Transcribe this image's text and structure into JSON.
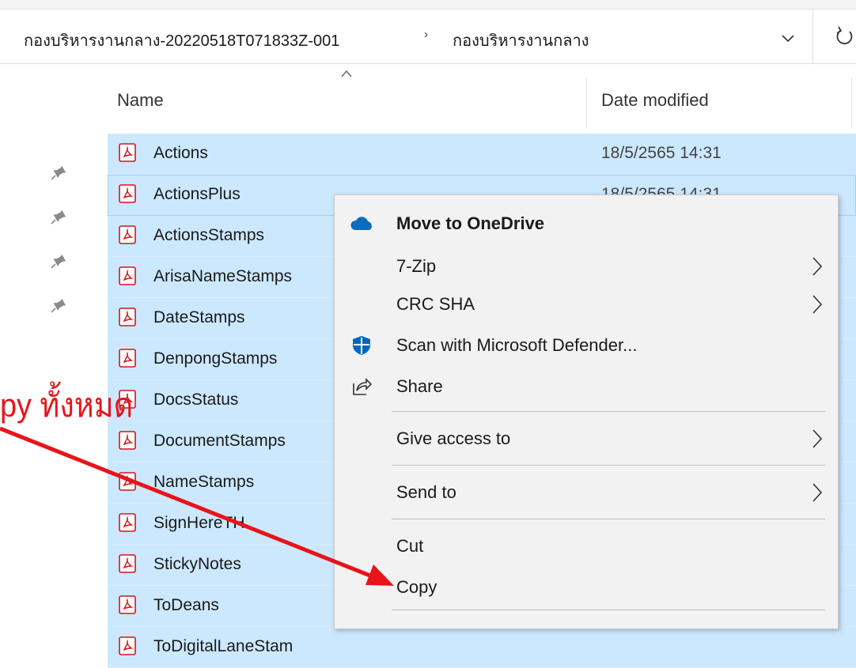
{
  "address_bar": {
    "segments": [
      "กองบริหารงานกลาง-20220518T071833Z-001",
      "กองบริหารงานกลาง"
    ],
    "separator": "›",
    "dropdown_icon": "chevron-down-icon",
    "refresh_icon": "refresh-icon"
  },
  "columns": {
    "name": "Name",
    "date_modified": "Date modified",
    "sort_icon": "sort-up-icon"
  },
  "files": [
    {
      "name": "Actions",
      "date": "18/5/2565 14:31"
    },
    {
      "name": "ActionsPlus",
      "date": "18/5/2565 14:31"
    },
    {
      "name": "ActionsStamps",
      "date": ""
    },
    {
      "name": "ArisaNameStamps",
      "date": ""
    },
    {
      "name": "DateStamps",
      "date": ""
    },
    {
      "name": "DenpongStamps",
      "date": ""
    },
    {
      "name": "DocsStatus",
      "date": ""
    },
    {
      "name": "DocumentStamps",
      "date": ""
    },
    {
      "name": "NameStamps",
      "date": ""
    },
    {
      "name": "SignHereTH",
      "date": ""
    },
    {
      "name": "StickyNotes",
      "date": ""
    },
    {
      "name": "ToDeans",
      "date": ""
    },
    {
      "name": "ToDigitalLaneStam",
      "date": ""
    }
  ],
  "context_menu": {
    "items": [
      {
        "label": "Move to OneDrive",
        "icon": "onedrive-cloud-icon",
        "submenu": false,
        "bold": true
      },
      {
        "label": "7-Zip",
        "icon": "",
        "submenu": true
      },
      {
        "label": "CRC SHA",
        "icon": "",
        "submenu": true
      },
      {
        "label": "Scan with Microsoft Defender...",
        "icon": "defender-shield-icon",
        "submenu": false
      },
      {
        "label": "Share",
        "icon": "share-icon",
        "submenu": false
      },
      {
        "label": "Give access to",
        "icon": "",
        "submenu": true
      },
      {
        "label": "Send to",
        "icon": "",
        "submenu": true
      },
      {
        "label": "Cut",
        "icon": "",
        "submenu": false
      },
      {
        "label": "Copy",
        "icon": "",
        "submenu": false
      }
    ]
  },
  "annotation": {
    "text": "py ทั้งหมด",
    "color": "#e8141a"
  },
  "colors": {
    "selection": "#cce8ff",
    "menu_bg": "#f2f2f2",
    "pdf_red": "#d0161b",
    "onedrive_blue": "#0f6cbd",
    "defender_blue": "#0067c0"
  }
}
